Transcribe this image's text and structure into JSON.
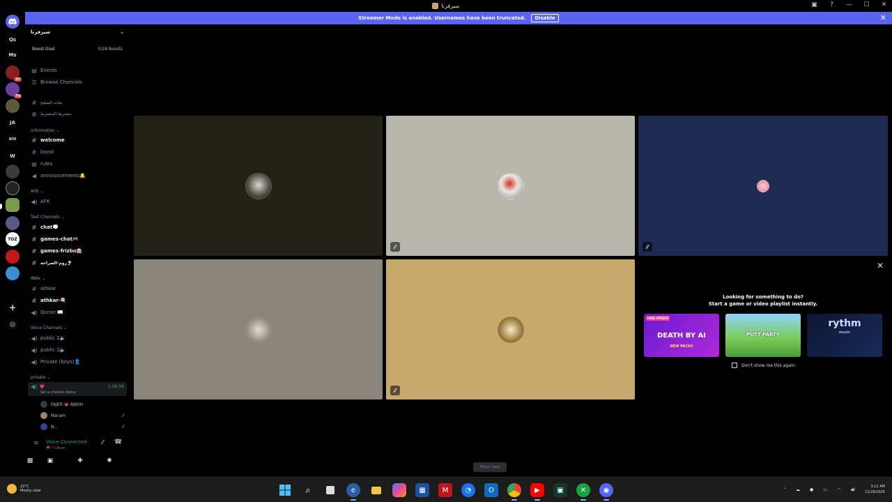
{
  "window": {
    "title": "سيرفرنا"
  },
  "banner": {
    "text": "Streamer Mode is enabled. Usernames have been truncated.",
    "disable_label": "Disable"
  },
  "servers": [
    {
      "label": "Qs"
    },
    {
      "label": "Ms"
    },
    {
      "label": "JA"
    },
    {
      "label": "800"
    },
    {
      "label": "W"
    }
  ],
  "server_badges": {
    "a": "37",
    "b": "74"
  },
  "sidebar": {
    "server_name": "سيرفرنا",
    "boost_goal_label": "Boost Goal",
    "boost_count": "0/28 Boosts",
    "events": "Events",
    "browse": "Browse Channels",
    "top_channels": [
      "شات-الشليج",
      "مشترط-المشترط"
    ],
    "cat_information": "Information",
    "information": [
      "welcome",
      "boost",
      "rules",
      "announcements🔔"
    ],
    "cat_afk": "AFK",
    "afk": [
      "AFK"
    ],
    "cat_text": "Text Channels",
    "text": [
      "chat💭",
      "games-chat🎮",
      "games-frizbo🎰",
      "روم-الصراحه🎐"
    ],
    "cat_ar": "🎟Ar",
    "ar": [
      "athkar",
      "athkar-🍭",
      "Quran-📖"
    ],
    "cat_voice": "Voice Channels",
    "voice": [
      "public 1🔈",
      "public 2🔈",
      "Private (boys)👤"
    ],
    "cat_private": "private",
    "active_voice_name": "💗",
    "active_voice_time": "1:26:56",
    "active_voice_status": "Set a channel status",
    "voice_users": [
      "FAJER 💗 AWSH",
      "Maram",
      "N.."
    ]
  },
  "voice_panel": {
    "connected": "Voice Connected",
    "channel": "💗 / سيرفرنا"
  },
  "activity": {
    "heading": "Looking for something to do?",
    "subheading": "Start a game or video playlist instantly.",
    "cards": [
      "DEATH BY AI",
      "PUTT PARTY",
      "rythm"
    ],
    "card_sub": [
      "NEW PACKS",
      "",
      "music"
    ],
    "card_tag": "FREE UPDATE",
    "dont_show": "Don't show me this again."
  },
  "stage_hint": "Focus view",
  "taskbar": {
    "temp": "22°C",
    "weather": "Mostly clear",
    "time": "3:12 AM",
    "date": "11/28/2025"
  },
  "colors": {
    "accent": "#5865f2",
    "green": "#23a55a",
    "red": "#f23f43"
  }
}
